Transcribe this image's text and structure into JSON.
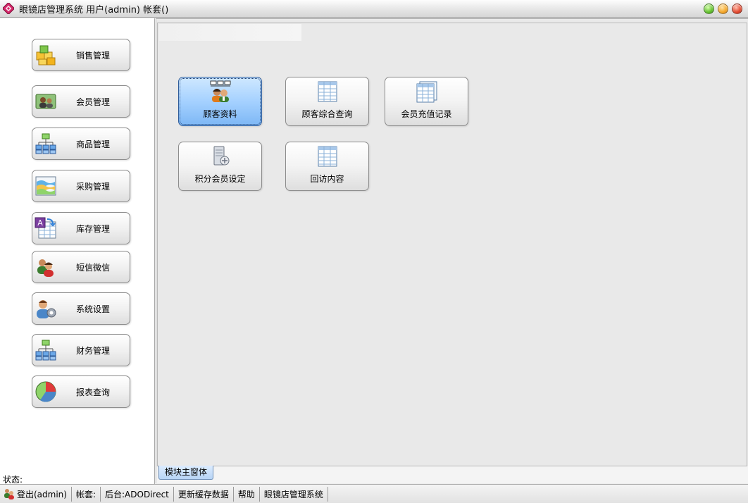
{
  "window": {
    "title": "眼镜店管理系统 用户(admin) 帐套()"
  },
  "sidebar": {
    "items": [
      {
        "label": "销售管理",
        "icon": "cubes-icon"
      },
      {
        "label": "会员管理",
        "icon": "member-card-icon"
      },
      {
        "label": "商品管理",
        "icon": "hierarchy-icon"
      },
      {
        "label": "采购管理",
        "icon": "wave-chart-icon"
      },
      {
        "label": "库存管理",
        "icon": "spreadsheet-icon"
      },
      {
        "label": "短信微信",
        "icon": "users-icon"
      },
      {
        "label": "系统设置",
        "icon": "user-settings-icon"
      },
      {
        "label": "财务管理",
        "icon": "hierarchy-icon"
      },
      {
        "label": "报表查询",
        "icon": "pie-chart-icon"
      }
    ]
  },
  "modules": [
    {
      "label": "顾客资料",
      "icon": "customers-icon",
      "active": true
    },
    {
      "label": "顾客综合查询",
      "icon": "grid-table-icon",
      "active": false
    },
    {
      "label": "会员充值记录",
      "icon": "record-table-icon",
      "active": false
    },
    {
      "label": "积分会员设定",
      "icon": "server-settings-icon",
      "active": false
    },
    {
      "label": "回访内容",
      "icon": "grid-table-icon",
      "active": false
    }
  ],
  "tabs": {
    "main_form": "模块主窗体"
  },
  "status_label": "状态:",
  "statusbar": {
    "logout": "登出(admin)",
    "account": "帐套:",
    "backend": "后台:ADODirect",
    "refresh_cache": "更新缓存数据",
    "help": "帮助",
    "app_name": "眼镜店管理系统"
  }
}
